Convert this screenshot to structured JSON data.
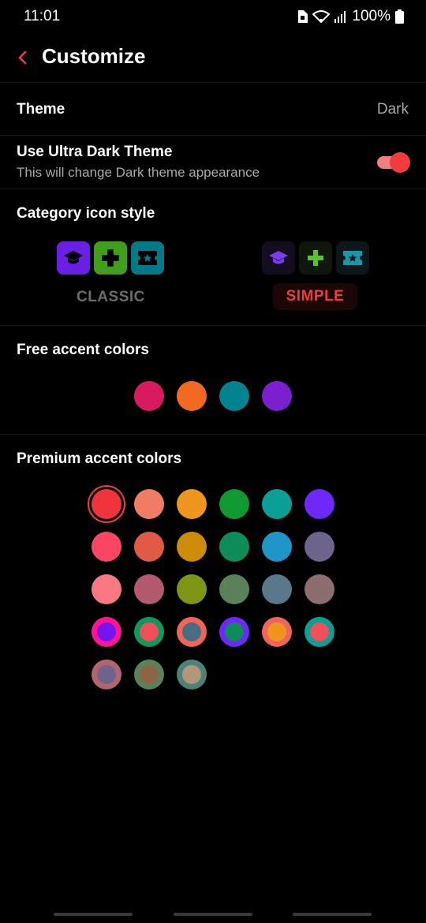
{
  "status_bar": {
    "time": "11:01",
    "battery": "100%"
  },
  "header": {
    "title": "Customize"
  },
  "theme": {
    "label": "Theme",
    "value": "Dark"
  },
  "ultra_dark": {
    "label": "Use Ultra Dark Theme",
    "description": "This will change Dark theme appearance",
    "enabled": true
  },
  "category_style": {
    "label": "Category icon style",
    "classic_label": "CLASSIC",
    "simple_label": "SIMPLE",
    "selected": "SIMPLE",
    "icons": [
      "graduation-cap-icon",
      "plus-icon",
      "ticket-icon"
    ]
  },
  "free_colors": {
    "label": "Free accent colors",
    "colors": [
      "#d81b60",
      "#f26a22",
      "#00838f",
      "#7b1fd0"
    ]
  },
  "premium_colors": {
    "label": "Premium accent colors",
    "selected_index": 0,
    "colors": [
      {
        "outer": "#f0343c",
        "inner": "#f0343c"
      },
      {
        "outer": "#f07c64",
        "inner": "#f07c64"
      },
      {
        "outer": "#f0961e",
        "inner": "#f0961e"
      },
      {
        "outer": "#0e9a30",
        "inner": "#0e9a30"
      },
      {
        "outer": "#0aa096",
        "inner": "#0aa096"
      },
      {
        "outer": "#6e28fa",
        "inner": "#6e28fa"
      },
      {
        "outer": "#fa4664",
        "inner": "#fa4664"
      },
      {
        "outer": "#e05a46",
        "inner": "#e05a46"
      },
      {
        "outer": "#cd8c0a",
        "inner": "#cd8c0a"
      },
      {
        "outer": "#0e8c5a",
        "inner": "#0e8c5a"
      },
      {
        "outer": "#1e96c8",
        "inner": "#1e96c8"
      },
      {
        "outer": "#6e648c",
        "inner": "#6e648c"
      },
      {
        "outer": "#fa7882",
        "inner": "#fa7882"
      },
      {
        "outer": "#b45a6e",
        "inner": "#b45a6e"
      },
      {
        "outer": "#7d9614",
        "inner": "#7d9614"
      },
      {
        "outer": "#5a825a",
        "inner": "#5a825a"
      },
      {
        "outer": "#5a788c",
        "inner": "#5a788c"
      },
      {
        "outer": "#8c6e6e",
        "inner": "#8c6e6e"
      },
      {
        "outer": "#ff1493",
        "inner": "#7814f0"
      },
      {
        "outer": "#0e9a5a",
        "inner": "#f0505a"
      },
      {
        "outer": "#f0645a",
        "inner": "#466e82"
      },
      {
        "outer": "#6e28fa",
        "inner": "#0e8c5a"
      },
      {
        "outer": "#f0645a",
        "inner": "#f0961e"
      },
      {
        "outer": "#0aa096",
        "inner": "#f0505a"
      },
      {
        "outer": "#b4646e",
        "inner": "#6e648c"
      },
      {
        "outer": "#5a825a",
        "inner": "#8c6446"
      },
      {
        "outer": "#4b827a",
        "inner": "#b49678"
      }
    ]
  },
  "colors": {
    "accent": "#f03c3c",
    "background": "#000000"
  }
}
